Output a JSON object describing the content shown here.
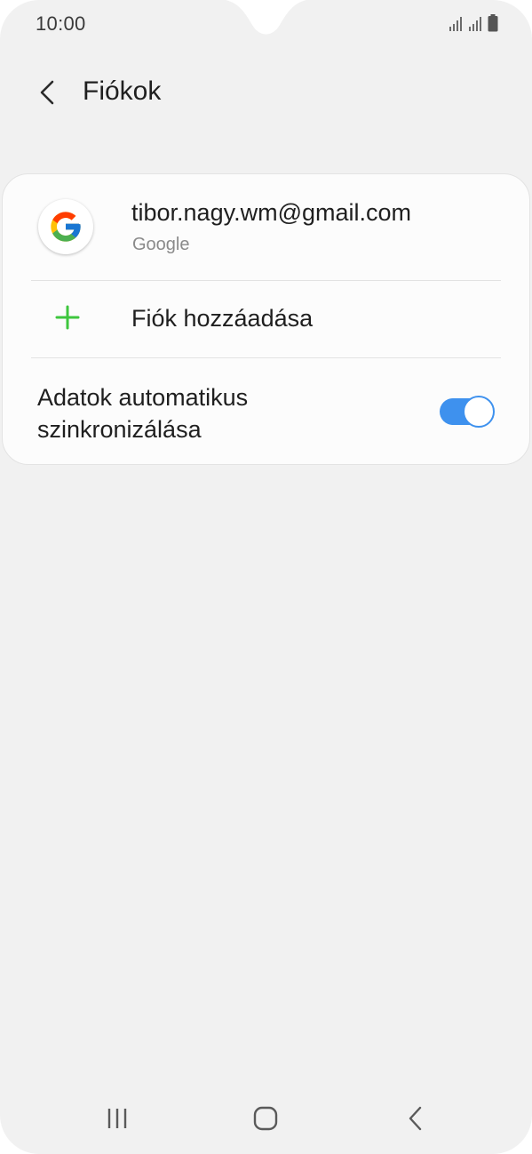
{
  "status_bar": {
    "time": "10:00"
  },
  "header": {
    "back_icon": "chevron-left-icon",
    "title": "Fiókok"
  },
  "accounts": [
    {
      "email": "tibor.nagy.wm@gmail.com",
      "type": "Google",
      "icon": "google-g-icon"
    }
  ],
  "add_account": {
    "icon": "plus-icon",
    "label": "Fiók hozzáadása",
    "accent_color": "#3ec63e"
  },
  "auto_sync": {
    "label": "Adatok automatikus szinkronizálása",
    "enabled": true,
    "accent_color": "#3e91ee"
  },
  "nav_bar": {
    "recents_icon": "recents-icon",
    "home_icon": "home-icon",
    "back_icon": "back-icon"
  }
}
